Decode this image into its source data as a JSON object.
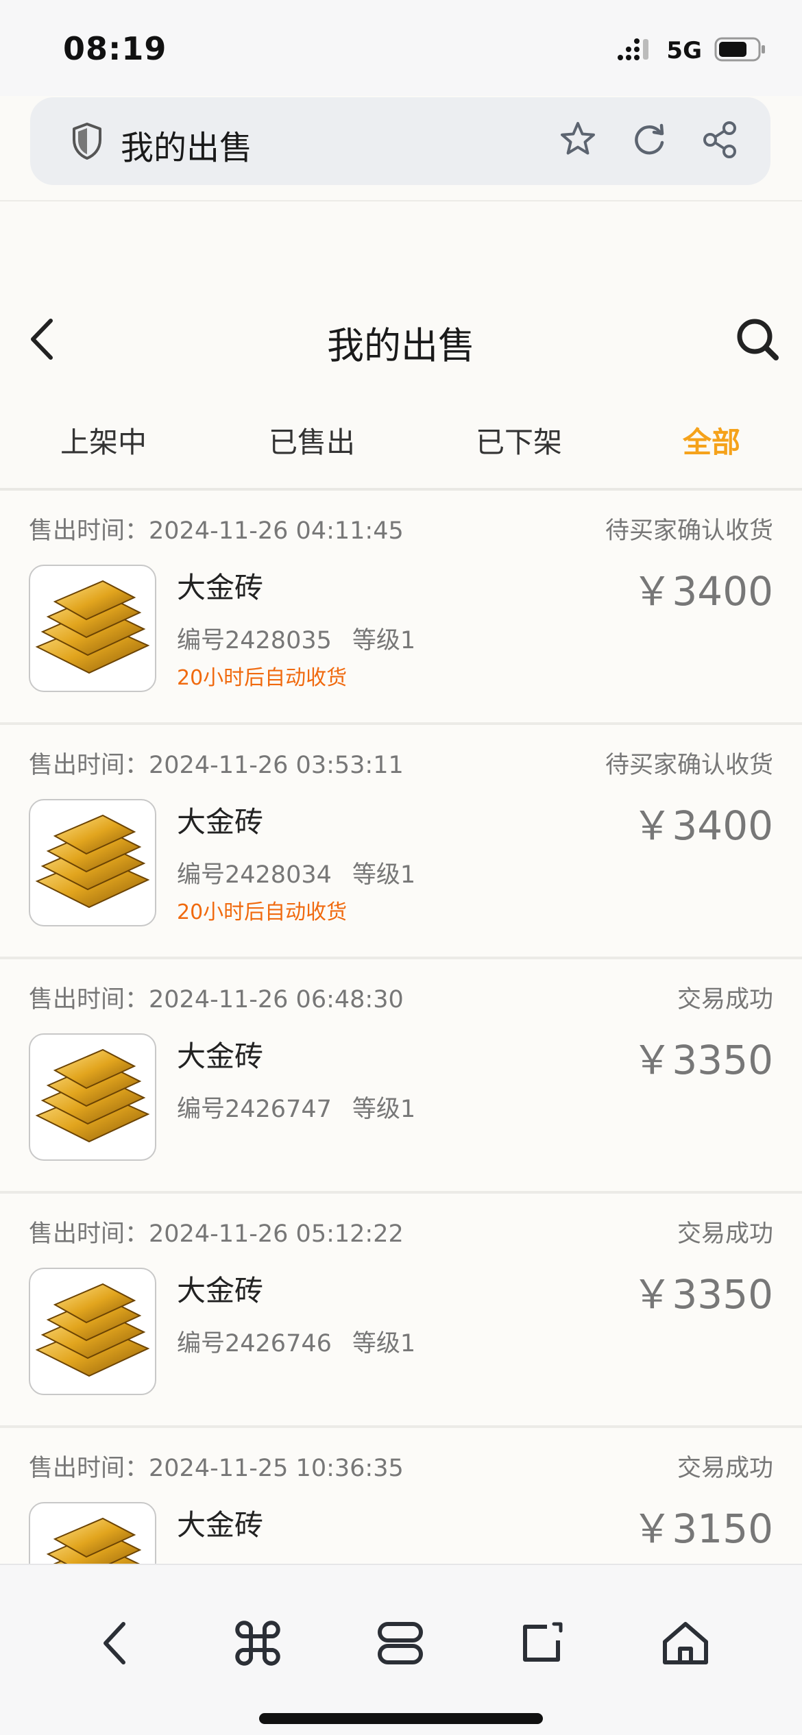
{
  "status_bar": {
    "time": "08:19",
    "network": "5G",
    "signal_icon": "signal-icon",
    "battery_icon": "battery-icon"
  },
  "browser": {
    "title": "我的出售",
    "shield_icon": "shield-icon",
    "actions": [
      "star-icon",
      "refresh-icon",
      "share-icon"
    ]
  },
  "header": {
    "title": "我的出售",
    "back_icon": "chevron-left-icon",
    "search_icon": "search-icon"
  },
  "tabs": [
    {
      "label": "上架中",
      "active": false
    },
    {
      "label": "已售出",
      "active": false
    },
    {
      "label": "已下架",
      "active": false
    },
    {
      "label": "全部",
      "active": true
    }
  ],
  "colors": {
    "accent": "#f5a21b",
    "note": "#f06a0f",
    "muted": "#777777"
  },
  "orders": [
    {
      "time_label": "售出时间：",
      "time": "2024-11-26 04:11:45",
      "status": "待买家确认收货",
      "name": "大金砖",
      "code": "编号2428035",
      "level": "等级1",
      "note": "20小时后自动收货",
      "price": "￥3400"
    },
    {
      "time_label": "售出时间：",
      "time": "2024-11-26 03:53:11",
      "status": "待买家确认收货",
      "name": "大金砖",
      "code": "编号2428034",
      "level": "等级1",
      "note": "20小时后自动收货",
      "price": "￥3400"
    },
    {
      "time_label": "售出时间：",
      "time": "2024-11-26 06:48:30",
      "status": "交易成功",
      "name": "大金砖",
      "code": "编号2426747",
      "level": "等级1",
      "note": "",
      "price": "￥3350"
    },
    {
      "time_label": "售出时间：",
      "time": "2024-11-26 05:12:22",
      "status": "交易成功",
      "name": "大金砖",
      "code": "编号2426746",
      "level": "等级1",
      "note": "",
      "price": "￥3350"
    },
    {
      "time_label": "售出时间：",
      "time": "2024-11-25 10:36:35",
      "status": "交易成功",
      "name": "大金砖",
      "code": "",
      "level": "",
      "note": "",
      "price": "￥3150"
    }
  ],
  "bottom_nav": [
    "back-icon",
    "command-icon",
    "tabs-icon",
    "tab-switch-icon",
    "home-icon"
  ]
}
